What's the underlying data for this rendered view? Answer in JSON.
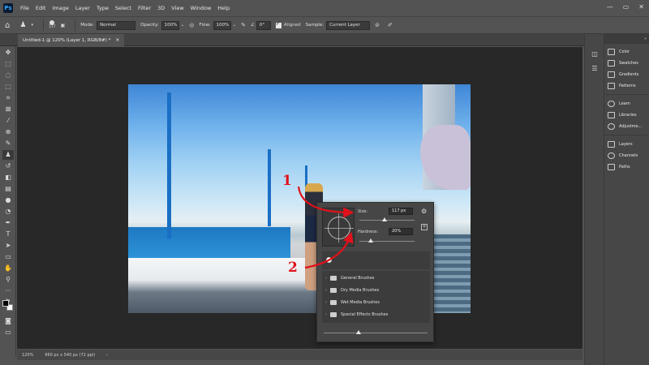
{
  "app": {
    "logo_text": "Ps"
  },
  "menu": [
    "File",
    "Edit",
    "Image",
    "Layer",
    "Type",
    "Select",
    "Filter",
    "3D",
    "View",
    "Window",
    "Help"
  ],
  "window_controls": {
    "minimize": "—",
    "restore": "▭",
    "close": "✕"
  },
  "options_bar": {
    "brush_size": "117",
    "mode_label": "Mode:",
    "mode_value": "Normal",
    "opacity_label": "Opacity:",
    "opacity_value": "100%",
    "flow_label": "Flow:",
    "flow_value": "100%",
    "angle_value": "0°",
    "aligned_label": "Aligned",
    "sample_label": "Sample:",
    "sample_value": "Current Layer"
  },
  "document_tab": {
    "title": "Untitled-1 @ 120% (Layer 1, RGB/8#) *",
    "close": "×"
  },
  "brush_panel": {
    "size_label": "Size:",
    "size_value": "117 px",
    "hardness_label": "Hardness:",
    "hardness_value": "20%",
    "size_fraction": 0.45,
    "hardness_fraction": 0.2,
    "folders": [
      "General Brushes",
      "Dry Media Brushes",
      "Wet Media Brushes",
      "Special Effects Brushes"
    ]
  },
  "annotations": {
    "step1": "1",
    "step2": "2",
    "color": "#e0111b"
  },
  "status_bar": {
    "zoom": "120%",
    "doc_info": "960 px x 540 px (72 ppi)"
  },
  "panels_primary": [
    "Color",
    "Swatches",
    "Gradients",
    "Patterns"
  ],
  "panels_secondary": [
    "Learn",
    "Libraries",
    "Adjustme..."
  ],
  "panels_tertiary": [
    "Layers",
    "Channels",
    "Paths"
  ]
}
